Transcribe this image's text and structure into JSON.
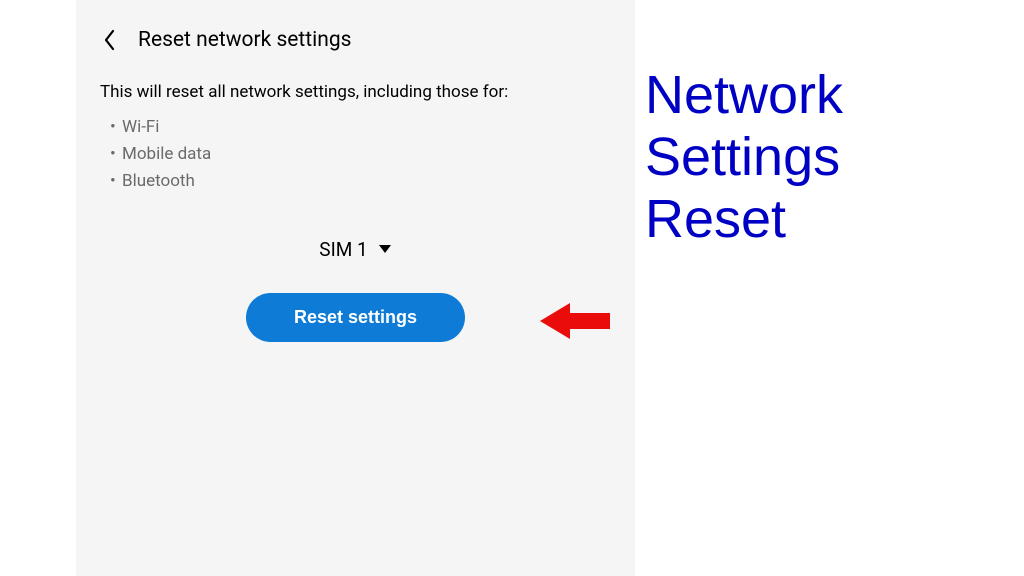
{
  "header": {
    "title": "Reset network settings"
  },
  "description": "This will reset all network settings, including those for:",
  "items": [
    "Wi-Fi",
    "Mobile data",
    "Bluetooth"
  ],
  "sim": {
    "label": "SIM 1"
  },
  "button": {
    "label": "Reset settings"
  },
  "annotation": {
    "line1": "Network Settings",
    "line2": "Reset"
  },
  "colors": {
    "button_bg": "#0e7cd6",
    "annotation_arrow": "#ea0b0b",
    "annotation_text": "#0000c4"
  }
}
